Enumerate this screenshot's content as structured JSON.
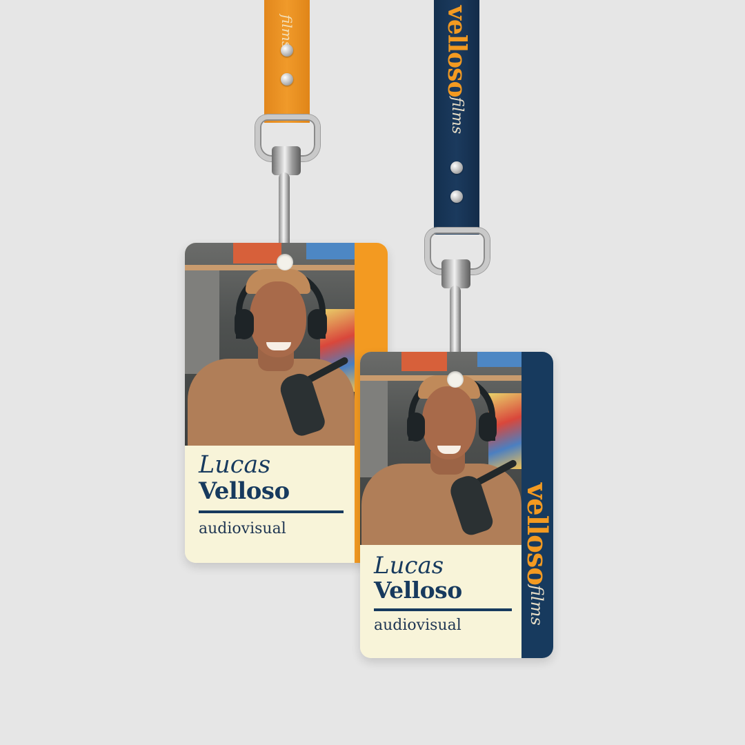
{
  "colors": {
    "background": "#e6e6e6",
    "orange": "#f39a21",
    "navy": "#173a5e",
    "cream": "#f8f4d9"
  },
  "badges": [
    {
      "first_name": "Lucas",
      "last_name": "Velloso",
      "role": "audiovisual",
      "brand_main": "velloso",
      "brand_sub": "films",
      "strap_color": "orange",
      "strap_text": "films"
    },
    {
      "first_name": "Lucas",
      "last_name": "Velloso",
      "role": "audiovisual",
      "brand_main": "velloso",
      "brand_sub": "films",
      "strap_color": "navy",
      "strap_brand_main": "velloso",
      "strap_brand_sub": "films"
    }
  ]
}
